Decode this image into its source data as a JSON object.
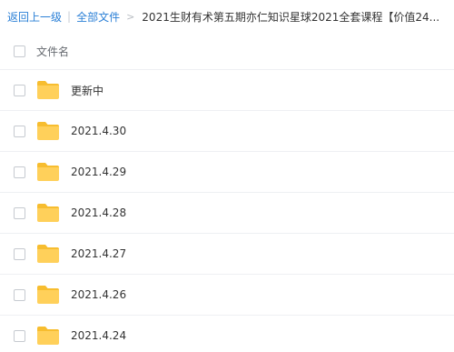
{
  "breadcrumb": {
    "back": "返回上一级",
    "separator": "|",
    "all_files": "全部文件",
    "arrow": ">",
    "current": "2021生财有术第五期亦仁知识星球2021全套课程【价值24..."
  },
  "list_header": {
    "column_name": "文件名"
  },
  "files": [
    {
      "name": "更新中"
    },
    {
      "name": "2021.4.30"
    },
    {
      "name": "2021.4.29"
    },
    {
      "name": "2021.4.28"
    },
    {
      "name": "2021.4.27"
    },
    {
      "name": "2021.4.26"
    },
    {
      "name": "2021.4.24"
    }
  ],
  "colors": {
    "link": "#2a7fd6",
    "folder": "#ffd05a",
    "folder_tab": "#f7bd2f"
  },
  "icons": {
    "folder": "folder-icon",
    "checkbox": "checkbox"
  }
}
